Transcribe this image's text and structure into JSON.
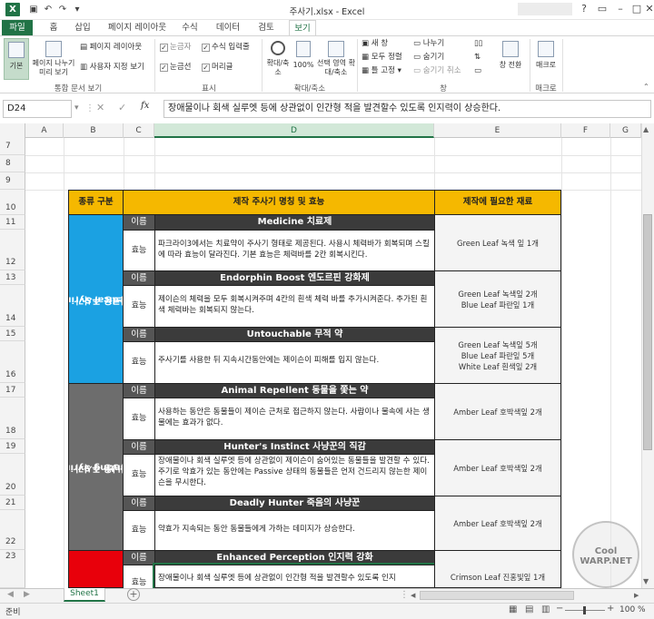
{
  "window": {
    "title": "주사기.xlsx - Excel",
    "user": "",
    "logo": "X"
  },
  "tabs": [
    "파일",
    "홈",
    "삽입",
    "페이지 레이아웃",
    "수식",
    "데이터",
    "검토",
    "보기"
  ],
  "ribbon": {
    "views": {
      "normal": "기본",
      "pagebreak": "페이지 나누기 미리 보기",
      "pagelayout": "페이지 레이아웃",
      "custom": "사용자 지정 보기",
      "group": "통합 문서 보기"
    },
    "show": {
      "ruler": "눈금자",
      "formulabar": "수식 입력줄",
      "gridlines": "눈금선",
      "headings": "머리글",
      "group": "표시"
    },
    "zoom": {
      "zoom": "확대/축소",
      "hundred": "100%",
      "selection": "선택 영역 확대/축소",
      "group": "확대/축소"
    },
    "window": {
      "new": "새 창",
      "arrange": "모두 정렬",
      "freeze": "틀 고정",
      "split": "나누기",
      "hide": "숨기기",
      "unhide": "숨기기 취소",
      "switch": "창 전환",
      "group": "창"
    },
    "macros": {
      "macro": "매크로",
      "group": "매크로"
    }
  },
  "formula": {
    "namebox": "D24",
    "cancel": "✕",
    "enter": "✓",
    "fx": "fx",
    "content": "장애물이나 회색 실루엣 등에 상관없이 인간형 적을 발견할수 있도록 인지력이 상승한다."
  },
  "columns": [
    "A",
    "B",
    "C",
    "D",
    "E",
    "F",
    "G"
  ],
  "rows": [
    "7",
    "8",
    "9",
    "10",
    "11",
    "12",
    "13",
    "14",
    "15",
    "16",
    "17",
    "18",
    "19",
    "20",
    "21",
    "22",
    "23"
  ],
  "table": {
    "headers": {
      "category": "종류 구분",
      "name": "제작 주사기 명칭 및 효능",
      "materials": "제작에 필요한 재료"
    },
    "label_name": "이름",
    "label_effect": "효능",
    "categories": [
      {
        "line1": "Medical Syringes",
        "line2": "의료용 주사기",
        "color": "#1ba1e2"
      },
      {
        "line1": "Hunting Syringes",
        "line2": "사냥용 주사기",
        "color": "#6d6d6d"
      },
      {
        "line1": "",
        "line2": "",
        "color": "#e8000b"
      }
    ],
    "items": [
      {
        "name": "Medicine 치료제",
        "desc": "파크라이3에서는 치료약이 주사기 형태로 제공된다. 사용시 체력바가 회복되며 스킬에 따라 효능이 달라진다. 기본 효능은 체력바를 2칸 회복시킨다.",
        "mat": [
          "Green Leaf 녹색 잎 1개"
        ]
      },
      {
        "name": "Endorphin Boost 엔도르핀 강화제",
        "desc": "제이슨의 체력을 모두 회복시켜주며 4칸의 흰색 체력 바를 추가시켜준다. 추가된 흰색 체력바는 회복되지 않는다.",
        "mat": [
          "Green Leaf 녹색잎 2개",
          "Blue Leaf 파란잎 1개"
        ]
      },
      {
        "name": "Untouchable 무적 약",
        "desc": "주사기를 사용한 뒤 지속시간동안에는 제이슨이 피해를 입지 않는다.",
        "mat": [
          "Green Leaf 녹색잎 5개",
          "Blue Leaf 파란잎 5개",
          "White Leaf 흰색잎 2개"
        ]
      },
      {
        "name": "Animal Repellent 동물을 쫓는 약",
        "desc": "사용하는 동안은 동물들이 제이슨 근처로 접근하지 않는다. 사람이나 물속에 사는 생물에는 효과가 없다.",
        "mat": [
          "Amber Leaf 호박색잎 2개"
        ]
      },
      {
        "name": "Hunter's Instinct 사냥꾼의 직감",
        "desc": "장애물이나 회색 실루엣 등에 상관없이 제이슨이 숨어있는 동물들을 발견할 수 있다. 주기로 악효가 있는 동안에는 Passive 상태의 동물들은 언저 건드리지 않는한 제이슨을 무시한다.",
        "mat": [
          "Amber Leaf 호박색잎 2개"
        ]
      },
      {
        "name": "Deadly Hunter 죽음의 사냥꾼",
        "desc": "약효가 지속되는 동안 동물들에게 가하는 데미지가 상승한다.",
        "mat": [
          "Amber Leaf 호박색잎 2개"
        ]
      },
      {
        "name": "Enhanced Perception 인지력 강화",
        "desc": "장애물이나 회색 실루엣 등에 상관없이 인간형 적을 발견할수 있도록 인지",
        "mat": [
          "Crimson Leaf 진홍빛잎 1개"
        ]
      }
    ]
  },
  "sheets": [
    "Sheet1"
  ],
  "status": {
    "ready": "준비",
    "zoom": "100 %"
  },
  "watermark": "Cool WARP.NET"
}
